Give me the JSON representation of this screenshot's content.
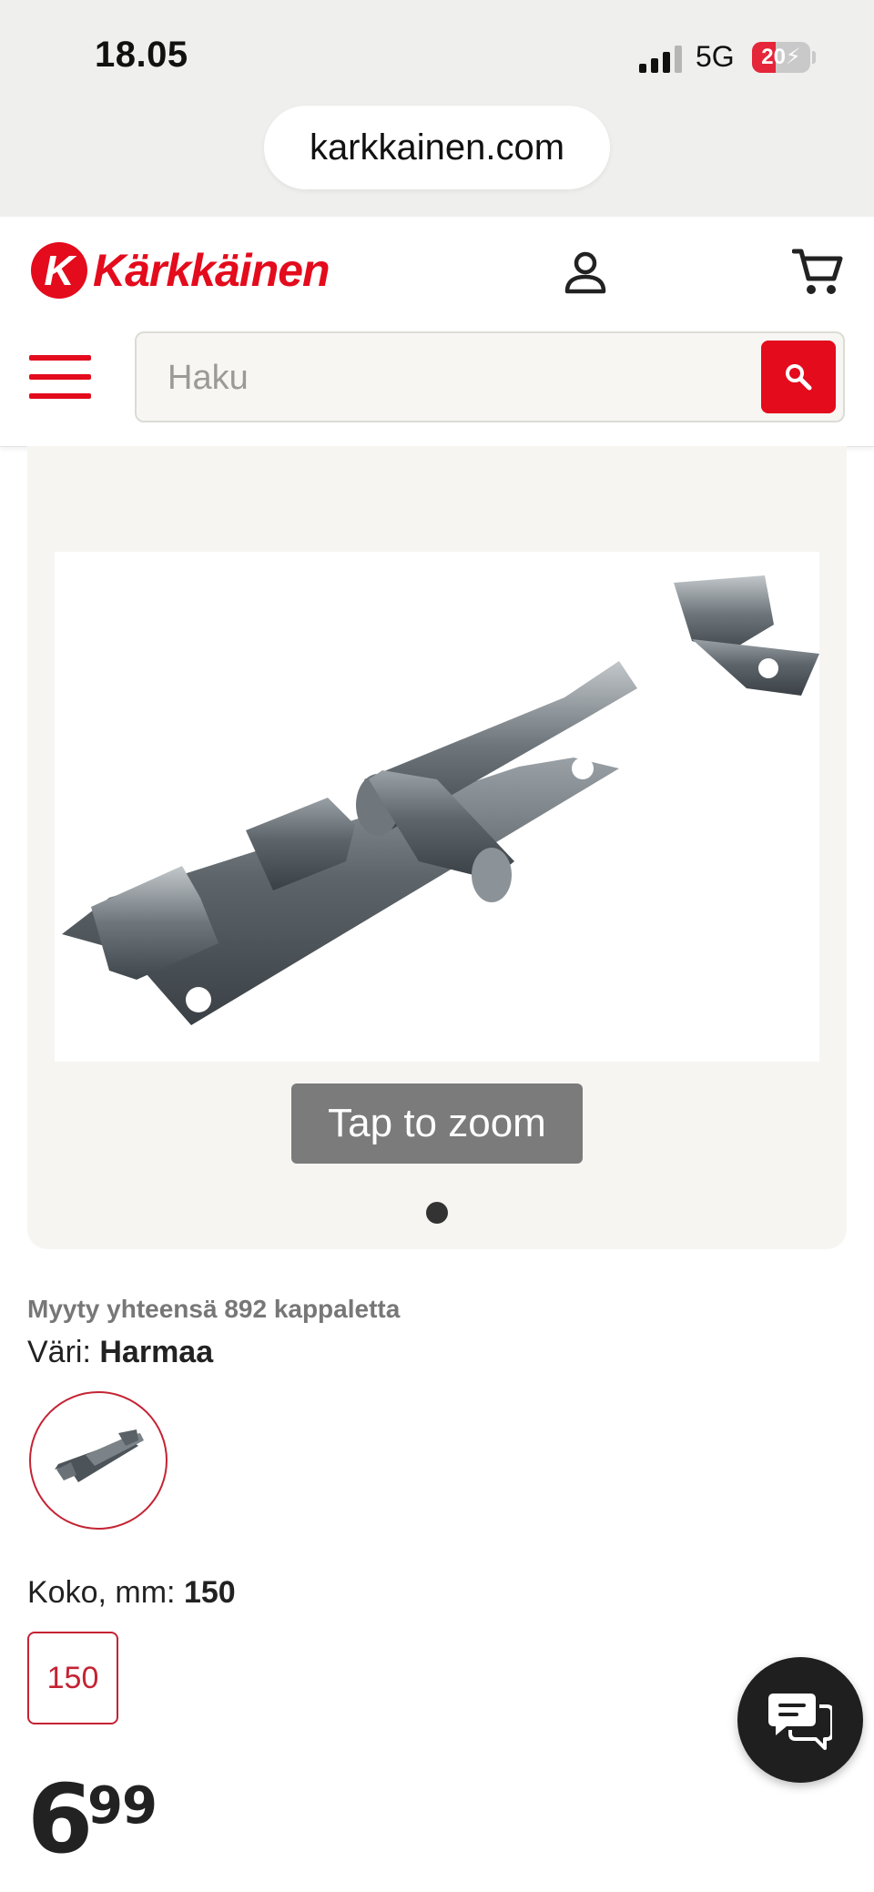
{
  "status_bar": {
    "time": "18.05",
    "network": "5G",
    "battery": "20",
    "battery_level_percent": 20
  },
  "browser": {
    "url": "karkkainen.com"
  },
  "header": {
    "logo_letter": "K",
    "logo_text": "Kärkkäinen",
    "brand_color": "#e30b1c",
    "icons": [
      "user-icon",
      "cart-icon",
      "menu-icon",
      "search-icon"
    ]
  },
  "search": {
    "placeholder": "Haku",
    "value": ""
  },
  "gallery": {
    "zoom_label": "Tap to zoom",
    "slide_count": 1,
    "active_slide": 1
  },
  "product": {
    "sold_text": "Myyty yhteensä 892 kappaletta",
    "color_label": "Väri:",
    "color_value": "Harmaa",
    "size_label": "Koko, mm:",
    "size_value": "150",
    "size_options": [
      "150"
    ],
    "price_integer": "6",
    "price_decimals": "99"
  },
  "chat": {
    "icon": "chat-icon"
  }
}
